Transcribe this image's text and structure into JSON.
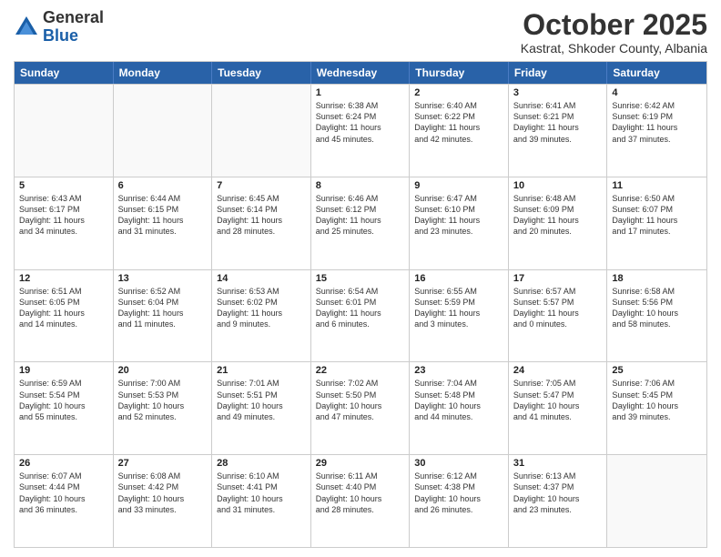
{
  "header": {
    "logo_general": "General",
    "logo_blue": "Blue",
    "month_title": "October 2025",
    "subtitle": "Kastrat, Shkoder County, Albania"
  },
  "weekdays": [
    "Sunday",
    "Monday",
    "Tuesday",
    "Wednesday",
    "Thursday",
    "Friday",
    "Saturday"
  ],
  "rows": [
    [
      {
        "day": "",
        "lines": []
      },
      {
        "day": "",
        "lines": []
      },
      {
        "day": "",
        "lines": []
      },
      {
        "day": "1",
        "lines": [
          "Sunrise: 6:38 AM",
          "Sunset: 6:24 PM",
          "Daylight: 11 hours",
          "and 45 minutes."
        ]
      },
      {
        "day": "2",
        "lines": [
          "Sunrise: 6:40 AM",
          "Sunset: 6:22 PM",
          "Daylight: 11 hours",
          "and 42 minutes."
        ]
      },
      {
        "day": "3",
        "lines": [
          "Sunrise: 6:41 AM",
          "Sunset: 6:21 PM",
          "Daylight: 11 hours",
          "and 39 minutes."
        ]
      },
      {
        "day": "4",
        "lines": [
          "Sunrise: 6:42 AM",
          "Sunset: 6:19 PM",
          "Daylight: 11 hours",
          "and 37 minutes."
        ]
      }
    ],
    [
      {
        "day": "5",
        "lines": [
          "Sunrise: 6:43 AM",
          "Sunset: 6:17 PM",
          "Daylight: 11 hours",
          "and 34 minutes."
        ]
      },
      {
        "day": "6",
        "lines": [
          "Sunrise: 6:44 AM",
          "Sunset: 6:15 PM",
          "Daylight: 11 hours",
          "and 31 minutes."
        ]
      },
      {
        "day": "7",
        "lines": [
          "Sunrise: 6:45 AM",
          "Sunset: 6:14 PM",
          "Daylight: 11 hours",
          "and 28 minutes."
        ]
      },
      {
        "day": "8",
        "lines": [
          "Sunrise: 6:46 AM",
          "Sunset: 6:12 PM",
          "Daylight: 11 hours",
          "and 25 minutes."
        ]
      },
      {
        "day": "9",
        "lines": [
          "Sunrise: 6:47 AM",
          "Sunset: 6:10 PM",
          "Daylight: 11 hours",
          "and 23 minutes."
        ]
      },
      {
        "day": "10",
        "lines": [
          "Sunrise: 6:48 AM",
          "Sunset: 6:09 PM",
          "Daylight: 11 hours",
          "and 20 minutes."
        ]
      },
      {
        "day": "11",
        "lines": [
          "Sunrise: 6:50 AM",
          "Sunset: 6:07 PM",
          "Daylight: 11 hours",
          "and 17 minutes."
        ]
      }
    ],
    [
      {
        "day": "12",
        "lines": [
          "Sunrise: 6:51 AM",
          "Sunset: 6:05 PM",
          "Daylight: 11 hours",
          "and 14 minutes."
        ]
      },
      {
        "day": "13",
        "lines": [
          "Sunrise: 6:52 AM",
          "Sunset: 6:04 PM",
          "Daylight: 11 hours",
          "and 11 minutes."
        ]
      },
      {
        "day": "14",
        "lines": [
          "Sunrise: 6:53 AM",
          "Sunset: 6:02 PM",
          "Daylight: 11 hours",
          "and 9 minutes."
        ]
      },
      {
        "day": "15",
        "lines": [
          "Sunrise: 6:54 AM",
          "Sunset: 6:01 PM",
          "Daylight: 11 hours",
          "and 6 minutes."
        ]
      },
      {
        "day": "16",
        "lines": [
          "Sunrise: 6:55 AM",
          "Sunset: 5:59 PM",
          "Daylight: 11 hours",
          "and 3 minutes."
        ]
      },
      {
        "day": "17",
        "lines": [
          "Sunrise: 6:57 AM",
          "Sunset: 5:57 PM",
          "Daylight: 11 hours",
          "and 0 minutes."
        ]
      },
      {
        "day": "18",
        "lines": [
          "Sunrise: 6:58 AM",
          "Sunset: 5:56 PM",
          "Daylight: 10 hours",
          "and 58 minutes."
        ]
      }
    ],
    [
      {
        "day": "19",
        "lines": [
          "Sunrise: 6:59 AM",
          "Sunset: 5:54 PM",
          "Daylight: 10 hours",
          "and 55 minutes."
        ]
      },
      {
        "day": "20",
        "lines": [
          "Sunrise: 7:00 AM",
          "Sunset: 5:53 PM",
          "Daylight: 10 hours",
          "and 52 minutes."
        ]
      },
      {
        "day": "21",
        "lines": [
          "Sunrise: 7:01 AM",
          "Sunset: 5:51 PM",
          "Daylight: 10 hours",
          "and 49 minutes."
        ]
      },
      {
        "day": "22",
        "lines": [
          "Sunrise: 7:02 AM",
          "Sunset: 5:50 PM",
          "Daylight: 10 hours",
          "and 47 minutes."
        ]
      },
      {
        "day": "23",
        "lines": [
          "Sunrise: 7:04 AM",
          "Sunset: 5:48 PM",
          "Daylight: 10 hours",
          "and 44 minutes."
        ]
      },
      {
        "day": "24",
        "lines": [
          "Sunrise: 7:05 AM",
          "Sunset: 5:47 PM",
          "Daylight: 10 hours",
          "and 41 minutes."
        ]
      },
      {
        "day": "25",
        "lines": [
          "Sunrise: 7:06 AM",
          "Sunset: 5:45 PM",
          "Daylight: 10 hours",
          "and 39 minutes."
        ]
      }
    ],
    [
      {
        "day": "26",
        "lines": [
          "Sunrise: 6:07 AM",
          "Sunset: 4:44 PM",
          "Daylight: 10 hours",
          "and 36 minutes."
        ]
      },
      {
        "day": "27",
        "lines": [
          "Sunrise: 6:08 AM",
          "Sunset: 4:42 PM",
          "Daylight: 10 hours",
          "and 33 minutes."
        ]
      },
      {
        "day": "28",
        "lines": [
          "Sunrise: 6:10 AM",
          "Sunset: 4:41 PM",
          "Daylight: 10 hours",
          "and 31 minutes."
        ]
      },
      {
        "day": "29",
        "lines": [
          "Sunrise: 6:11 AM",
          "Sunset: 4:40 PM",
          "Daylight: 10 hours",
          "and 28 minutes."
        ]
      },
      {
        "day": "30",
        "lines": [
          "Sunrise: 6:12 AM",
          "Sunset: 4:38 PM",
          "Daylight: 10 hours",
          "and 26 minutes."
        ]
      },
      {
        "day": "31",
        "lines": [
          "Sunrise: 6:13 AM",
          "Sunset: 4:37 PM",
          "Daylight: 10 hours",
          "and 23 minutes."
        ]
      },
      {
        "day": "",
        "lines": []
      }
    ]
  ]
}
